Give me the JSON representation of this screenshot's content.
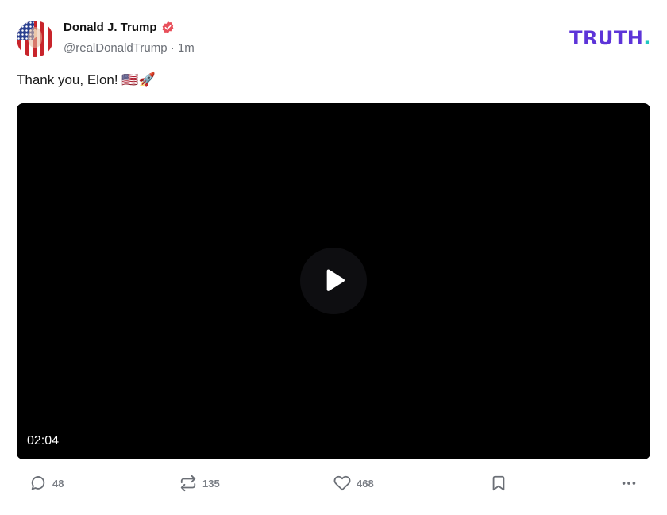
{
  "author": {
    "name": "Donald J. Trump",
    "handle": "@realDonaldTrump",
    "time": "1m",
    "verified_color": "#e8505b"
  },
  "brand": {
    "logo_text": "TRUTH",
    "logo_dot": ".",
    "color": "#5d34d8",
    "dot_color": "#20c7c0"
  },
  "post": {
    "text": "Thank you, Elon! 🇺🇸🚀"
  },
  "video": {
    "duration": "02:04",
    "play_icon": "play-icon"
  },
  "actions": {
    "replies": "48",
    "retruths": "135",
    "likes": "468"
  },
  "icons": {
    "reply": "comment-icon",
    "retruth": "repost-icon",
    "like": "heart-icon",
    "bookmark": "bookmark-icon",
    "more": "more-horizontal-icon"
  }
}
